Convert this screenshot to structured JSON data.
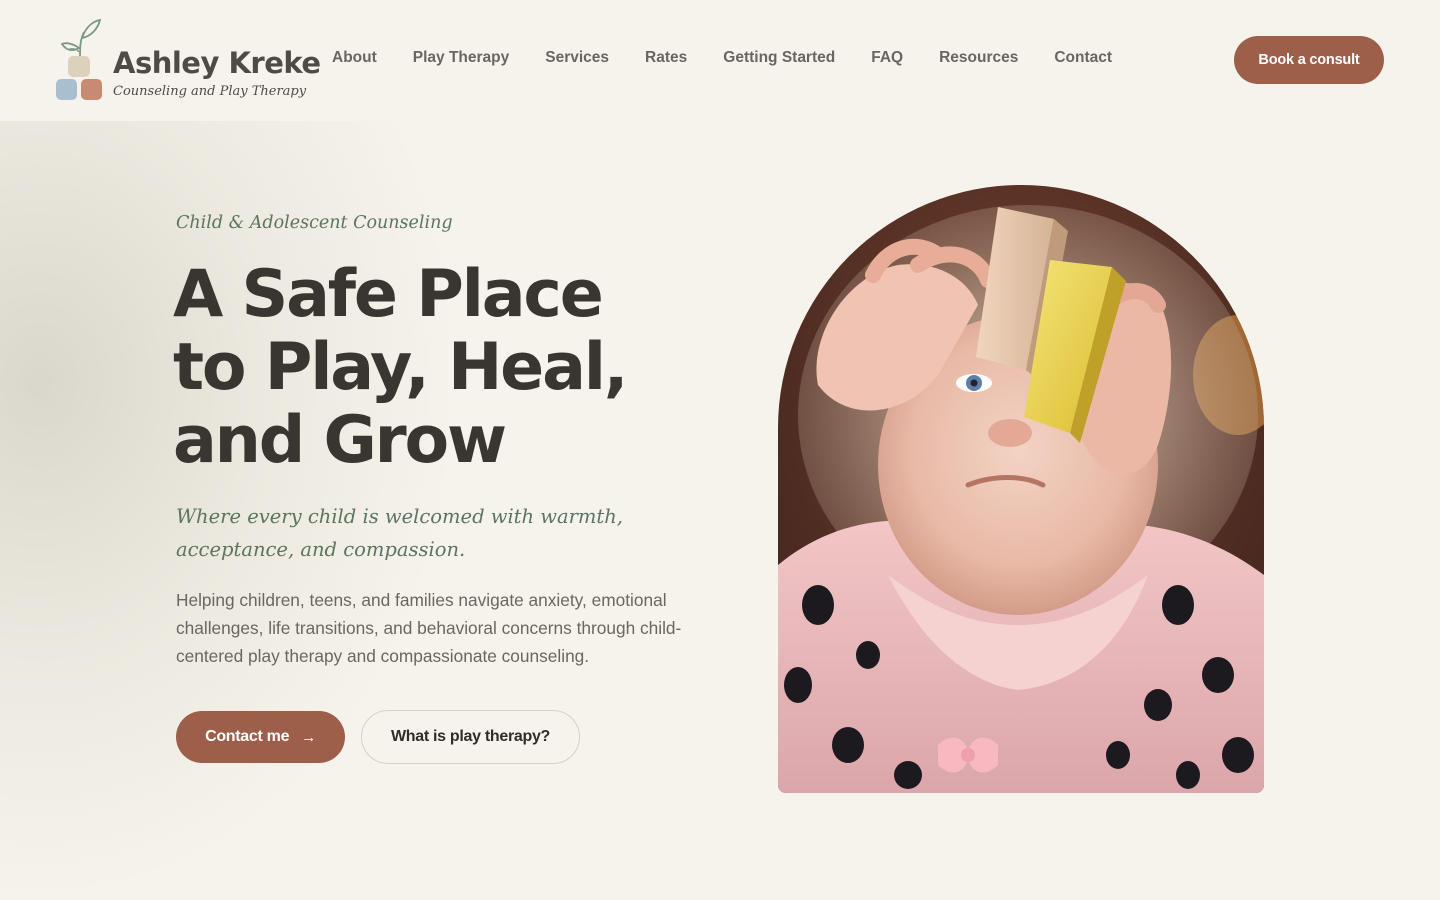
{
  "brand": {
    "name": "Ashley Kreke",
    "tagline": "Counseling and Play Therapy",
    "icon": "block-stack-sprout-logo"
  },
  "nav": {
    "items": [
      "About",
      "Play Therapy",
      "Services",
      "Rates",
      "Getting Started",
      "FAQ",
      "Resources",
      "Contact"
    ],
    "cta_label": "Book a consult"
  },
  "hero": {
    "eyebrow": "Child & Adolescent Counseling",
    "headline_lines": [
      "A Safe Place",
      "to Play, Heal,",
      "and Grow"
    ],
    "subhead": "Where every child is welcomed with warmth, acceptance, and compassion.",
    "body": "Helping children, teens, and families navigate anxiety, emotional challenges, life transitions, and behavioral concerns through child-centered play therapy and compassionate counseling.",
    "primary_cta": "Contact me",
    "primary_cta_icon": "arrow-right-icon",
    "secondary_cta": "What is play therapy?",
    "image_subject": "toddler holding wooden blocks"
  },
  "colors": {
    "background": "#f6f3ec",
    "accent": "#9d5f4a",
    "sage": "#5b7560",
    "heading": "#393632",
    "body_text": "#6b6660"
  }
}
